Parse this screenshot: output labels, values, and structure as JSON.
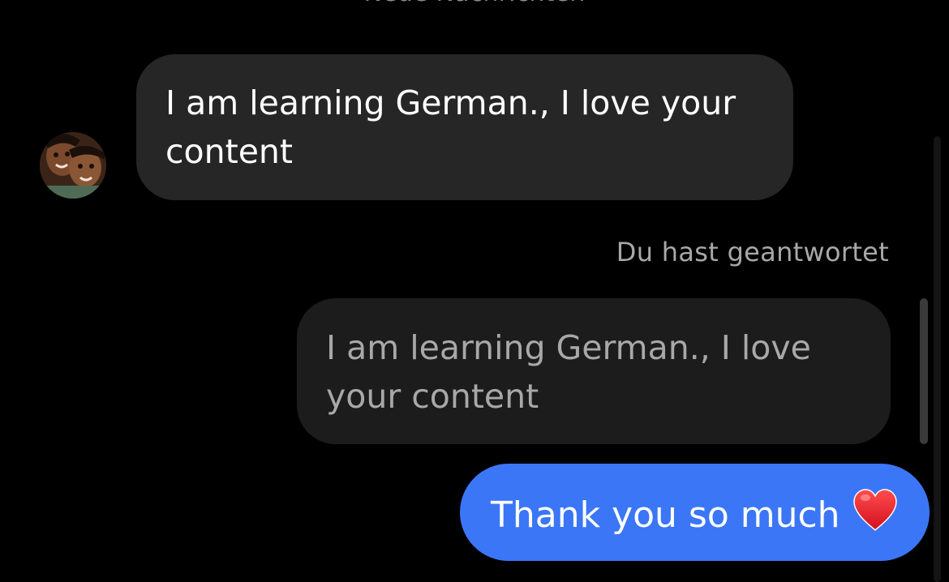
{
  "thread": {
    "divider_label": "Neue Nachrichten",
    "messages": [
      {
        "direction": "incoming",
        "text": "I am learning German., I love your content"
      }
    ],
    "reply_context": {
      "label": "Du hast geantwortet",
      "quoted_text": "I am learning German., I love your content"
    },
    "outgoing": {
      "text": "Thank you so much",
      "emoji": "red-heart"
    }
  },
  "colors": {
    "background": "#000000",
    "incoming_bubble": "#262626",
    "quoted_bubble": "#1c1c1c",
    "outgoing_bubble": "#3b76f6",
    "secondary_text": "#a8a8a8"
  }
}
